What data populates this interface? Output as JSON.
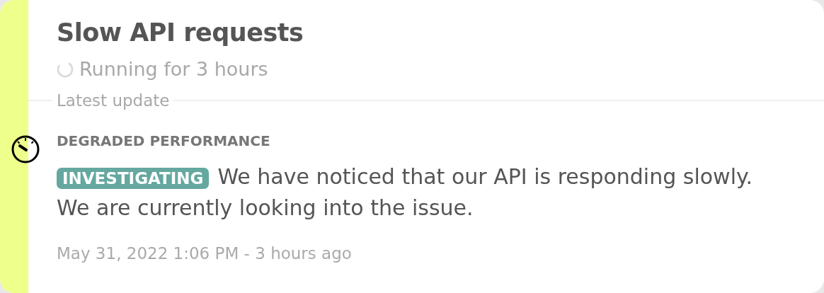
{
  "incident": {
    "title": "Slow API requests",
    "duration": "Running for 3 hours"
  },
  "latest_update": {
    "heading": "Latest update",
    "impact": "DEGRADED PERFORMANCE",
    "status": "INVESTIGATING",
    "message": "We have noticed that our API is responding slowly. We are currently looking into the issue.",
    "timestamp": "May 31, 2022 1:06 PM - 3 hours ago"
  }
}
